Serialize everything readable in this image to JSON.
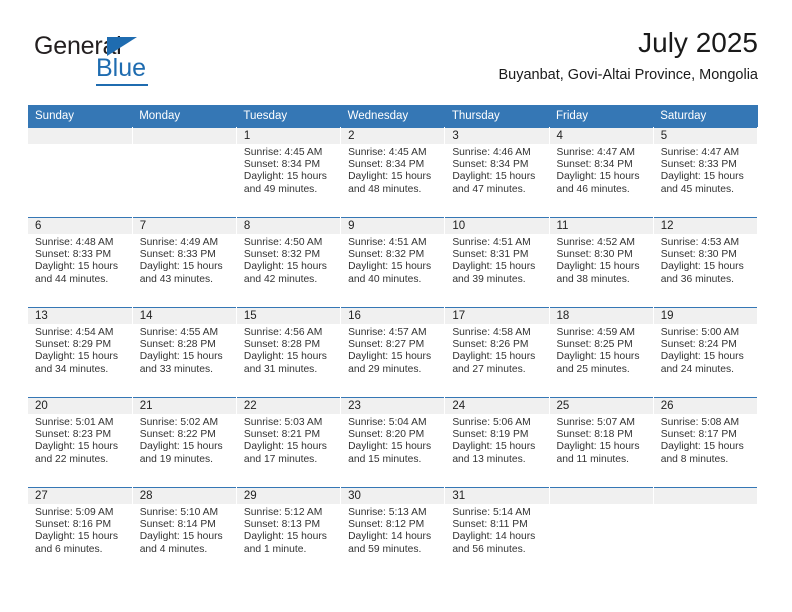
{
  "brand": {
    "name_part1": "General",
    "name_part2": "Blue"
  },
  "header": {
    "month_title": "July 2025",
    "location": "Buyanbat, Govi-Altai Province, Mongolia"
  },
  "colors": {
    "header_blue": "#3577b5",
    "brand_blue": "#1f6cb0",
    "daystrip_gray": "#f0f0f0"
  },
  "weekday_headers": [
    "Sunday",
    "Monday",
    "Tuesday",
    "Wednesday",
    "Thursday",
    "Friday",
    "Saturday"
  ],
  "weeks": [
    [
      {
        "day": "",
        "sunrise": "",
        "sunset": "",
        "daylight": ""
      },
      {
        "day": "",
        "sunrise": "",
        "sunset": "",
        "daylight": ""
      },
      {
        "day": "1",
        "sunrise": "Sunrise: 4:45 AM",
        "sunset": "Sunset: 8:34 PM",
        "daylight": "Daylight: 15 hours and 49 minutes."
      },
      {
        "day": "2",
        "sunrise": "Sunrise: 4:45 AM",
        "sunset": "Sunset: 8:34 PM",
        "daylight": "Daylight: 15 hours and 48 minutes."
      },
      {
        "day": "3",
        "sunrise": "Sunrise: 4:46 AM",
        "sunset": "Sunset: 8:34 PM",
        "daylight": "Daylight: 15 hours and 47 minutes."
      },
      {
        "day": "4",
        "sunrise": "Sunrise: 4:47 AM",
        "sunset": "Sunset: 8:34 PM",
        "daylight": "Daylight: 15 hours and 46 minutes."
      },
      {
        "day": "5",
        "sunrise": "Sunrise: 4:47 AM",
        "sunset": "Sunset: 8:33 PM",
        "daylight": "Daylight: 15 hours and 45 minutes."
      }
    ],
    [
      {
        "day": "6",
        "sunrise": "Sunrise: 4:48 AM",
        "sunset": "Sunset: 8:33 PM",
        "daylight": "Daylight: 15 hours and 44 minutes."
      },
      {
        "day": "7",
        "sunrise": "Sunrise: 4:49 AM",
        "sunset": "Sunset: 8:33 PM",
        "daylight": "Daylight: 15 hours and 43 minutes."
      },
      {
        "day": "8",
        "sunrise": "Sunrise: 4:50 AM",
        "sunset": "Sunset: 8:32 PM",
        "daylight": "Daylight: 15 hours and 42 minutes."
      },
      {
        "day": "9",
        "sunrise": "Sunrise: 4:51 AM",
        "sunset": "Sunset: 8:32 PM",
        "daylight": "Daylight: 15 hours and 40 minutes."
      },
      {
        "day": "10",
        "sunrise": "Sunrise: 4:51 AM",
        "sunset": "Sunset: 8:31 PM",
        "daylight": "Daylight: 15 hours and 39 minutes."
      },
      {
        "day": "11",
        "sunrise": "Sunrise: 4:52 AM",
        "sunset": "Sunset: 8:30 PM",
        "daylight": "Daylight: 15 hours and 38 minutes."
      },
      {
        "day": "12",
        "sunrise": "Sunrise: 4:53 AM",
        "sunset": "Sunset: 8:30 PM",
        "daylight": "Daylight: 15 hours and 36 minutes."
      }
    ],
    [
      {
        "day": "13",
        "sunrise": "Sunrise: 4:54 AM",
        "sunset": "Sunset: 8:29 PM",
        "daylight": "Daylight: 15 hours and 34 minutes."
      },
      {
        "day": "14",
        "sunrise": "Sunrise: 4:55 AM",
        "sunset": "Sunset: 8:28 PM",
        "daylight": "Daylight: 15 hours and 33 minutes."
      },
      {
        "day": "15",
        "sunrise": "Sunrise: 4:56 AM",
        "sunset": "Sunset: 8:28 PM",
        "daylight": "Daylight: 15 hours and 31 minutes."
      },
      {
        "day": "16",
        "sunrise": "Sunrise: 4:57 AM",
        "sunset": "Sunset: 8:27 PM",
        "daylight": "Daylight: 15 hours and 29 minutes."
      },
      {
        "day": "17",
        "sunrise": "Sunrise: 4:58 AM",
        "sunset": "Sunset: 8:26 PM",
        "daylight": "Daylight: 15 hours and 27 minutes."
      },
      {
        "day": "18",
        "sunrise": "Sunrise: 4:59 AM",
        "sunset": "Sunset: 8:25 PM",
        "daylight": "Daylight: 15 hours and 25 minutes."
      },
      {
        "day": "19",
        "sunrise": "Sunrise: 5:00 AM",
        "sunset": "Sunset: 8:24 PM",
        "daylight": "Daylight: 15 hours and 24 minutes."
      }
    ],
    [
      {
        "day": "20",
        "sunrise": "Sunrise: 5:01 AM",
        "sunset": "Sunset: 8:23 PM",
        "daylight": "Daylight: 15 hours and 22 minutes."
      },
      {
        "day": "21",
        "sunrise": "Sunrise: 5:02 AM",
        "sunset": "Sunset: 8:22 PM",
        "daylight": "Daylight: 15 hours and 19 minutes."
      },
      {
        "day": "22",
        "sunrise": "Sunrise: 5:03 AM",
        "sunset": "Sunset: 8:21 PM",
        "daylight": "Daylight: 15 hours and 17 minutes."
      },
      {
        "day": "23",
        "sunrise": "Sunrise: 5:04 AM",
        "sunset": "Sunset: 8:20 PM",
        "daylight": "Daylight: 15 hours and 15 minutes."
      },
      {
        "day": "24",
        "sunrise": "Sunrise: 5:06 AM",
        "sunset": "Sunset: 8:19 PM",
        "daylight": "Daylight: 15 hours and 13 minutes."
      },
      {
        "day": "25",
        "sunrise": "Sunrise: 5:07 AM",
        "sunset": "Sunset: 8:18 PM",
        "daylight": "Daylight: 15 hours and 11 minutes."
      },
      {
        "day": "26",
        "sunrise": "Sunrise: 5:08 AM",
        "sunset": "Sunset: 8:17 PM",
        "daylight": "Daylight: 15 hours and 8 minutes."
      }
    ],
    [
      {
        "day": "27",
        "sunrise": "Sunrise: 5:09 AM",
        "sunset": "Sunset: 8:16 PM",
        "daylight": "Daylight: 15 hours and 6 minutes."
      },
      {
        "day": "28",
        "sunrise": "Sunrise: 5:10 AM",
        "sunset": "Sunset: 8:14 PM",
        "daylight": "Daylight: 15 hours and 4 minutes."
      },
      {
        "day": "29",
        "sunrise": "Sunrise: 5:12 AM",
        "sunset": "Sunset: 8:13 PM",
        "daylight": "Daylight: 15 hours and 1 minute."
      },
      {
        "day": "30",
        "sunrise": "Sunrise: 5:13 AM",
        "sunset": "Sunset: 8:12 PM",
        "daylight": "Daylight: 14 hours and 59 minutes."
      },
      {
        "day": "31",
        "sunrise": "Sunrise: 5:14 AM",
        "sunset": "Sunset: 8:11 PM",
        "daylight": "Daylight: 14 hours and 56 minutes."
      },
      {
        "day": "",
        "sunrise": "",
        "sunset": "",
        "daylight": ""
      },
      {
        "day": "",
        "sunrise": "",
        "sunset": "",
        "daylight": ""
      }
    ]
  ]
}
